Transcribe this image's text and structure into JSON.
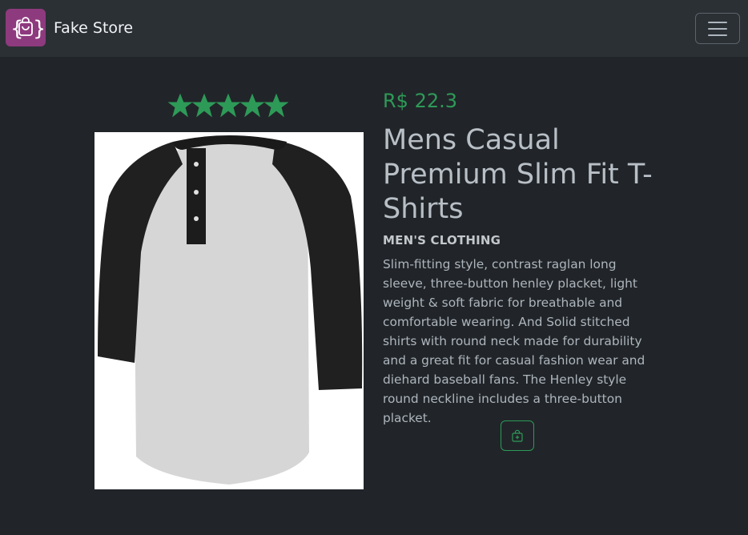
{
  "brand": {
    "name": "Fake Store",
    "icon": "shopping-bag-braces-icon",
    "logo_color": "#8e3a7e"
  },
  "navbar": {
    "toggler_icon": "hamburger-icon"
  },
  "product": {
    "rating": {
      "value": 5,
      "max": 5,
      "icon": "star-icon",
      "color": "#2e9a58"
    },
    "image_alt": "Mens Casual Premium Slim Fit T-Shirts",
    "price": "R$ 22.3",
    "title": "Mens Casual Premium Slim Fit T-Shirts",
    "category": "MEN'S CLOTHING",
    "description": "Slim-fitting style, contrast raglan long sleeve, three-button henley placket, light weight & soft fabric for breathable and comfortable wearing. And Solid stitched shirts with round neck made for durability and a great fit for casual fashion wear and diehard baseball fans. The Henley style round neckline includes a three-button placket.",
    "cart_button_icon": "add-to-cart-bag-icon"
  },
  "colors": {
    "background": "#212529",
    "navbar": "#2b3035",
    "accent": "#2e9a58"
  }
}
